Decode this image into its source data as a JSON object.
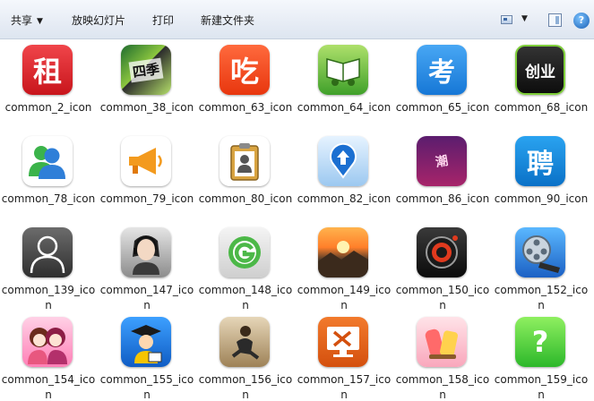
{
  "toolbar": {
    "share_label": "共享",
    "slideshow_label": "放映幻灯片",
    "print_label": "打印",
    "new_folder_label": "新建文件夹"
  },
  "icons": [
    {
      "label": "common_2_icon",
      "glyph": "租",
      "icon": "rent-icon"
    },
    {
      "label": "common_38_icon",
      "glyph": "四季",
      "icon": "seasons-icon"
    },
    {
      "label": "common_63_icon",
      "glyph": "吃",
      "icon": "eat-icon"
    },
    {
      "label": "common_64_icon",
      "glyph": "",
      "icon": "book-car-icon"
    },
    {
      "label": "common_65_icon",
      "glyph": "考",
      "icon": "exam-icon"
    },
    {
      "label": "common_68_icon",
      "glyph": "创业",
      "icon": "startup-icon"
    },
    {
      "label": "common_78_icon",
      "glyph": "",
      "icon": "users-icon"
    },
    {
      "label": "common_79_icon",
      "glyph": "",
      "icon": "megaphone-icon"
    },
    {
      "label": "common_80_icon",
      "glyph": "",
      "icon": "clipboard-user-icon"
    },
    {
      "label": "common_82_icon",
      "glyph": "",
      "icon": "upload-location-icon"
    },
    {
      "label": "common_86_icon",
      "glyph": "潮",
      "icon": "fashion-icon"
    },
    {
      "label": "common_90_icon",
      "glyph": "聘",
      "icon": "hire-icon"
    },
    {
      "label": "common_139_icon",
      "glyph": "",
      "icon": "person-silhouette-icon"
    },
    {
      "label": "common_147_icon",
      "glyph": "",
      "icon": "headset-operator-icon"
    },
    {
      "label": "common_148_icon",
      "glyph": "",
      "icon": "g-logo-icon"
    },
    {
      "label": "common_149_icon",
      "glyph": "",
      "icon": "sunset-landscape-icon"
    },
    {
      "label": "common_150_icon",
      "glyph": "",
      "icon": "camera-lens-icon"
    },
    {
      "label": "common_152_icon",
      "glyph": "",
      "icon": "film-reel-icon"
    },
    {
      "label": "common_154_icon",
      "glyph": "",
      "icon": "anime-girls-icon"
    },
    {
      "label": "common_155_icon",
      "glyph": "",
      "icon": "graduate-icon"
    },
    {
      "label": "common_156_icon",
      "glyph": "",
      "icon": "sitting-person-icon"
    },
    {
      "label": "common_157_icon",
      "glyph": "",
      "icon": "repair-tools-icon"
    },
    {
      "label": "common_158_icon",
      "glyph": "",
      "icon": "food-icon"
    },
    {
      "label": "common_159_icon",
      "glyph": "?",
      "icon": "question-bubble-icon"
    }
  ]
}
